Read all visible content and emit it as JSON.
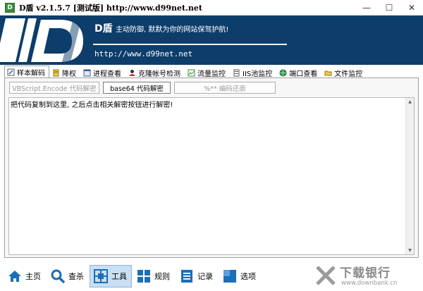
{
  "window": {
    "app_icon_glyph": "D",
    "title": "D盾 v2.1.5.7 [测试版] http://www.d99net.net",
    "minimize_glyph": "—",
    "maximize_glyph": "☐",
    "close_glyph": "✕"
  },
  "banner": {
    "name": "D盾",
    "slogan": "主动防御, 默默为你的网站保驾护航!",
    "url": "http://www.d99net.net",
    "bg_color": "#0d3d6a"
  },
  "tabs": [
    {
      "label": "样本解码",
      "icon": "pen-icon",
      "active": true
    },
    {
      "label": "降权",
      "icon": "document-icon",
      "active": false
    },
    {
      "label": "进程查看",
      "icon": "window-icon",
      "active": false
    },
    {
      "label": "克隆帐号检测",
      "icon": "user-icon",
      "active": false
    },
    {
      "label": "流量监控",
      "icon": "chart-icon",
      "active": false
    },
    {
      "label": "IIS池监控",
      "icon": "server-icon",
      "active": false
    },
    {
      "label": "端口查看",
      "icon": "globe-icon",
      "active": false
    },
    {
      "label": "文件监控",
      "icon": "folder-icon",
      "active": false
    }
  ],
  "buttons": {
    "vbscript": "VBScript.Encode 代码解密",
    "base64": "base64 代码解密",
    "percent": "%** 编码还原"
  },
  "editor": {
    "text": "把代码复制到这里, 之后点击相关解密按钮进行解密!",
    "scroll_up": "▲",
    "scroll_down": "▼"
  },
  "bottom_nav": [
    {
      "label": "主页",
      "icon": "home-icon",
      "active": false
    },
    {
      "label": "查杀",
      "icon": "search-icon",
      "active": false
    },
    {
      "label": "工具",
      "icon": "tools-icon",
      "active": true
    },
    {
      "label": "规则",
      "icon": "rules-icon",
      "active": false
    },
    {
      "label": "记录",
      "icon": "log-icon",
      "active": false
    },
    {
      "label": "选项",
      "icon": "options-icon",
      "active": false
    }
  ],
  "watermark": {
    "text": "下载银行",
    "sub": "www.downbank.cn"
  },
  "colors": {
    "accent_blue": "#1a6fb8",
    "nav_active_bg": "#c9dff3"
  }
}
